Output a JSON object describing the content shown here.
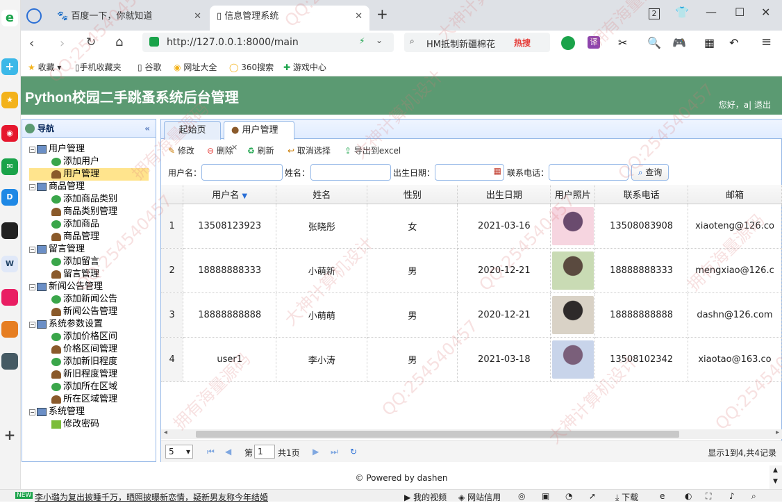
{
  "browser": {
    "tabs": [
      {
        "title": "百度一下，你就知道"
      },
      {
        "title": "信息管理系统"
      }
    ],
    "tab_count": "2",
    "url": "http://127.0.0.1:8000/main",
    "search_text": "HM抵制新疆棉花",
    "search_badge": "热搜",
    "bookmarks": [
      "收藏",
      "手机收藏夹",
      "谷歌",
      "网址大全",
      "360搜索",
      "游戏中心"
    ]
  },
  "app": {
    "title": "Python校园二手跳蚤系统后台管理",
    "greeting": "您好，a| 退出"
  },
  "sidebar": {
    "title": "导航",
    "groups": [
      {
        "label": "用户管理",
        "items": [
          "添加用户",
          "用户管理"
        ]
      },
      {
        "label": "商品管理",
        "items": [
          "添加商品类别",
          "商品类别管理",
          "添加商品",
          "商品管理"
        ]
      },
      {
        "label": "留言管理",
        "items": [
          "添加留言",
          "留言管理"
        ]
      },
      {
        "label": "新闻公告管理",
        "items": [
          "添加新闻公告",
          "新闻公告管理"
        ]
      },
      {
        "label": "系统参数设置",
        "items": [
          "添加价格区间",
          "价格区间管理",
          "添加新旧程度",
          "新旧程度管理",
          "添加所在区域",
          "所在区域管理"
        ]
      },
      {
        "label": "系统管理",
        "items": [
          "修改密码"
        ]
      }
    ],
    "selected": "用户管理"
  },
  "main": {
    "tabs": [
      "起始页",
      "用户管理"
    ],
    "toolbar": [
      "修改",
      "删除",
      "刷新",
      "取消选择",
      "导出到excel"
    ],
    "filters": {
      "username_label": "用户名：",
      "name_label": "姓名：",
      "birth_label": "出生日期：",
      "phone_label": "联系电话：",
      "query_label": "查询"
    },
    "columns": [
      "用户名",
      "姓名",
      "性别",
      "出生日期",
      "用户照片",
      "联系电话",
      "邮箱"
    ],
    "rows": [
      {
        "n": "1",
        "user": "13508123923",
        "name": "张晓彤",
        "sex": "女",
        "birth": "2021-03-16",
        "phone": "13508083908",
        "email": "xiaoteng@126.co"
      },
      {
        "n": "2",
        "user": "18888888333",
        "name": "小萌新",
        "sex": "男",
        "birth": "2020-12-21",
        "phone": "18888888333",
        "email": "mengxiao@126.c"
      },
      {
        "n": "3",
        "user": "18888888888",
        "name": "小萌萌",
        "sex": "男",
        "birth": "2020-12-21",
        "phone": "18888888888",
        "email": "dashn@126.com"
      },
      {
        "n": "4",
        "user": "user1",
        "name": "李小涛",
        "sex": "男",
        "birth": "2021-03-18",
        "phone": "13508102342",
        "email": "xiaotao@163.co"
      }
    ],
    "pager": {
      "page_size": "5",
      "page_prefix": "第",
      "page_value": "1",
      "page_total": "共1页",
      "summary": "显示1到4,共4记录"
    }
  },
  "footer": "© Powered by dashen",
  "statusbar": {
    "badge": "NEW",
    "news": "李小璐为复出披睡千万，晒照披曝新恋情，疑新男友称今年结婚",
    "items": [
      "我的视频",
      "网站信用",
      "下载"
    ]
  },
  "watermarks": [
    "QQ:254540457",
    "大神计算机设计",
    "拥有海量源码"
  ]
}
